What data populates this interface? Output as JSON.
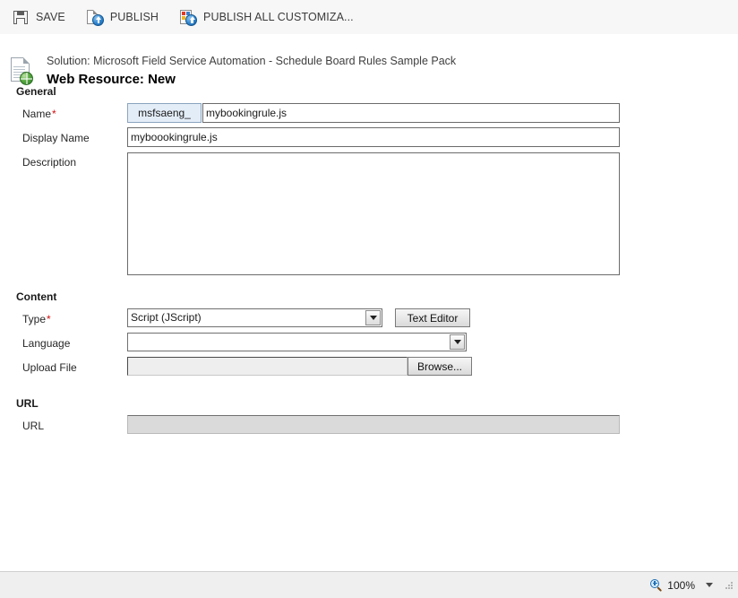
{
  "command_bar": {
    "buttons": [
      {
        "label": "SAVE",
        "icon": "save-icon"
      },
      {
        "label": "PUBLISH",
        "icon": "publish-icon"
      },
      {
        "label": "PUBLISH ALL CUSTOMIZA...",
        "icon": "publish-all-icon"
      }
    ]
  },
  "header": {
    "icon": "web-resource-icon",
    "solution_line": "Solution: Microsoft Field Service Automation - Schedule Board Rules Sample Pack",
    "record_title": "Web Resource: New"
  },
  "sections": {
    "general": {
      "title": "General",
      "name": {
        "label": "Name",
        "required_marker": "*",
        "prefix": "msfsaeng_",
        "value": "mybookingrule.js"
      },
      "display_name": {
        "label": "Display Name",
        "value": "myboookingrule.js"
      },
      "description": {
        "label": "Description",
        "value": ""
      }
    },
    "content": {
      "title": "Content",
      "type": {
        "label": "Type",
        "required_marker": "*",
        "selected": "Script (JScript)"
      },
      "language": {
        "label": "Language",
        "selected": ""
      },
      "upload_file": {
        "label": "Upload File",
        "value": "",
        "browse_label": "Browse..."
      },
      "text_editor_label": "Text Editor"
    },
    "url": {
      "title": "URL",
      "url_field": {
        "label": "URL",
        "value": ""
      }
    }
  },
  "status_bar": {
    "zoom_icon": "zoom-icon",
    "zoom_level": "100%"
  },
  "colors": {
    "command_bar_bg": "#f7f7f7",
    "page_bg": "#ffffff",
    "required_red": "#d11010",
    "prefix_bg": "#e3edf8",
    "readonly_bg": "#dadada",
    "status_bar_bg": "#efefef"
  }
}
